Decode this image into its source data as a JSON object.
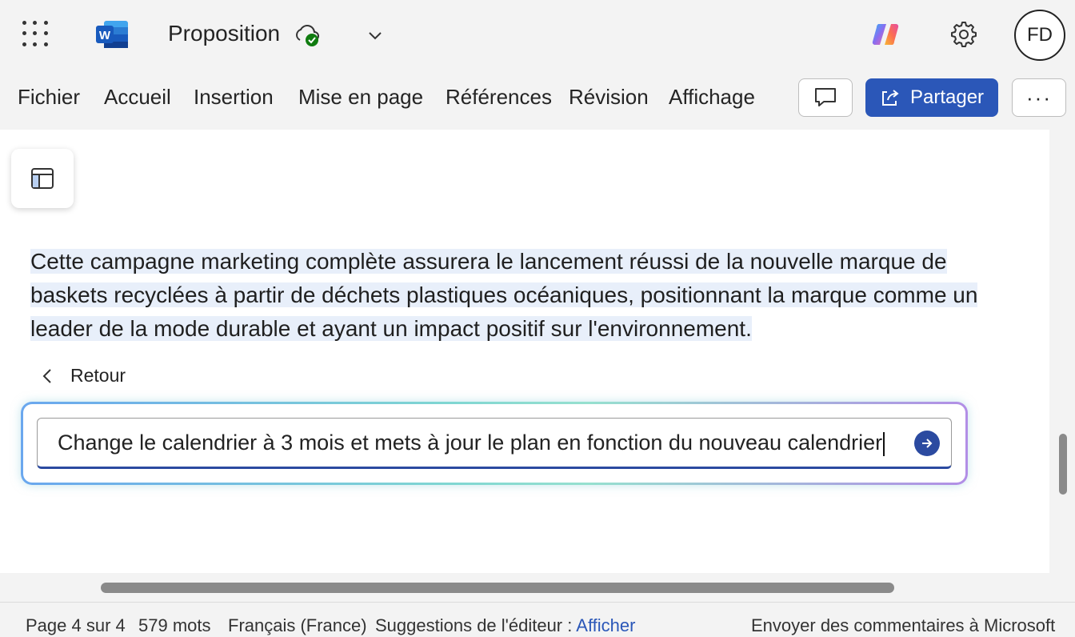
{
  "app": {
    "document_title": "Proposition",
    "avatar_initials": "FD",
    "brand_color": "#2b57b8",
    "icons": [
      "waffle-icon",
      "word-logo",
      "cloud-saved-icon",
      "chevron-down-icon",
      "copilot-icon",
      "gear-icon"
    ]
  },
  "ribbon": {
    "tabs": [
      "Fichier",
      "Accueil",
      "Insertion",
      "Mise en page",
      "Références",
      "Révision",
      "Affichage"
    ],
    "share_label": "Partager",
    "more_label": "···"
  },
  "document": {
    "paragraph_lines": [
      "Cette campagne marketing complète assurera le lancement réussi de la nouvelle marque de",
      "baskets recyclées à partir de déchets plastiques océaniques, positionnant la marque comme un",
      "leader de la mode durable et ayant un impact positif sur l'environnement."
    ],
    "highlight_color": "#e8effa"
  },
  "copilot": {
    "back_label": "Retour",
    "prompt_value": "Change le calendrier à 3 mois et mets à jour le plan en fonction du nouveau calendrier"
  },
  "status_bar": {
    "page": "Page 4 sur 4",
    "words": "579 mots",
    "language": "Français (France)",
    "editor_suggestions_label": "Suggestions de l'éditeur :",
    "editor_suggestions_link": "Afficher",
    "feedback": "Envoyer des commentaires à Microsoft"
  }
}
